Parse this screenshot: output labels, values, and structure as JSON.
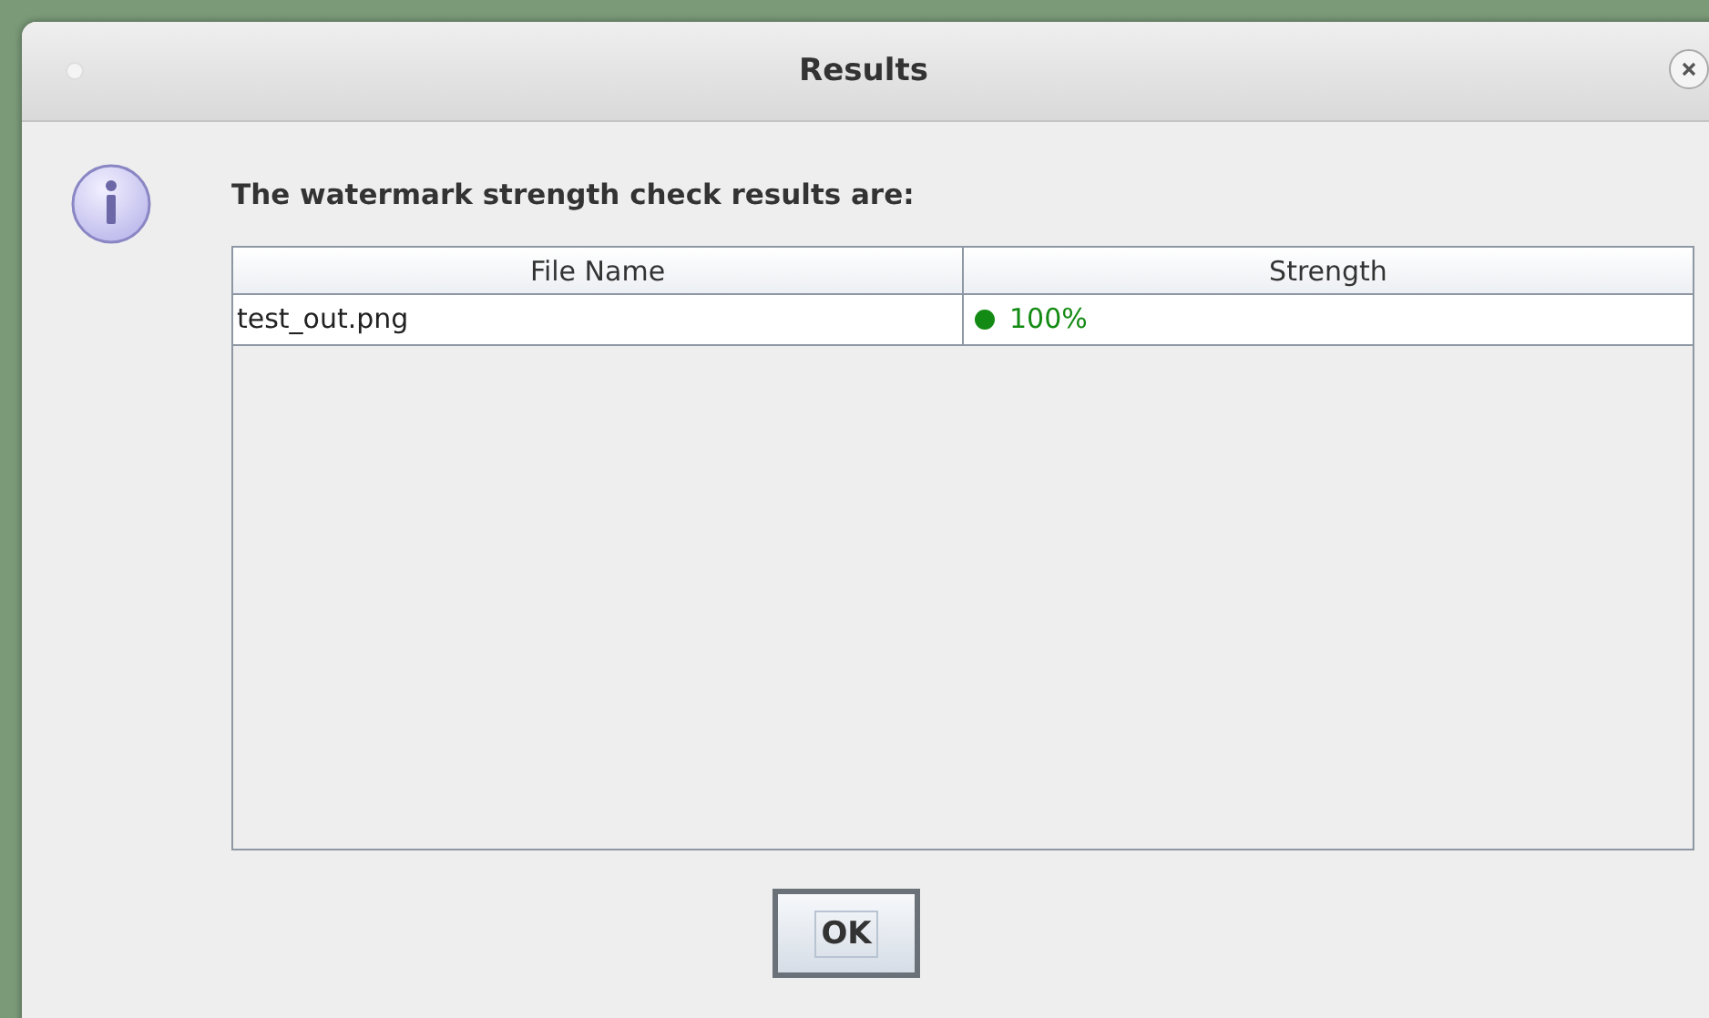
{
  "window": {
    "title": "Results"
  },
  "message": "The watermark strength check results are:",
  "table": {
    "columns": [
      "File Name",
      "Strength"
    ],
    "rows": [
      {
        "file": "test_out.png",
        "strength": "100%",
        "color": "#138a13"
      }
    ]
  },
  "buttons": [
    "OK"
  ]
}
